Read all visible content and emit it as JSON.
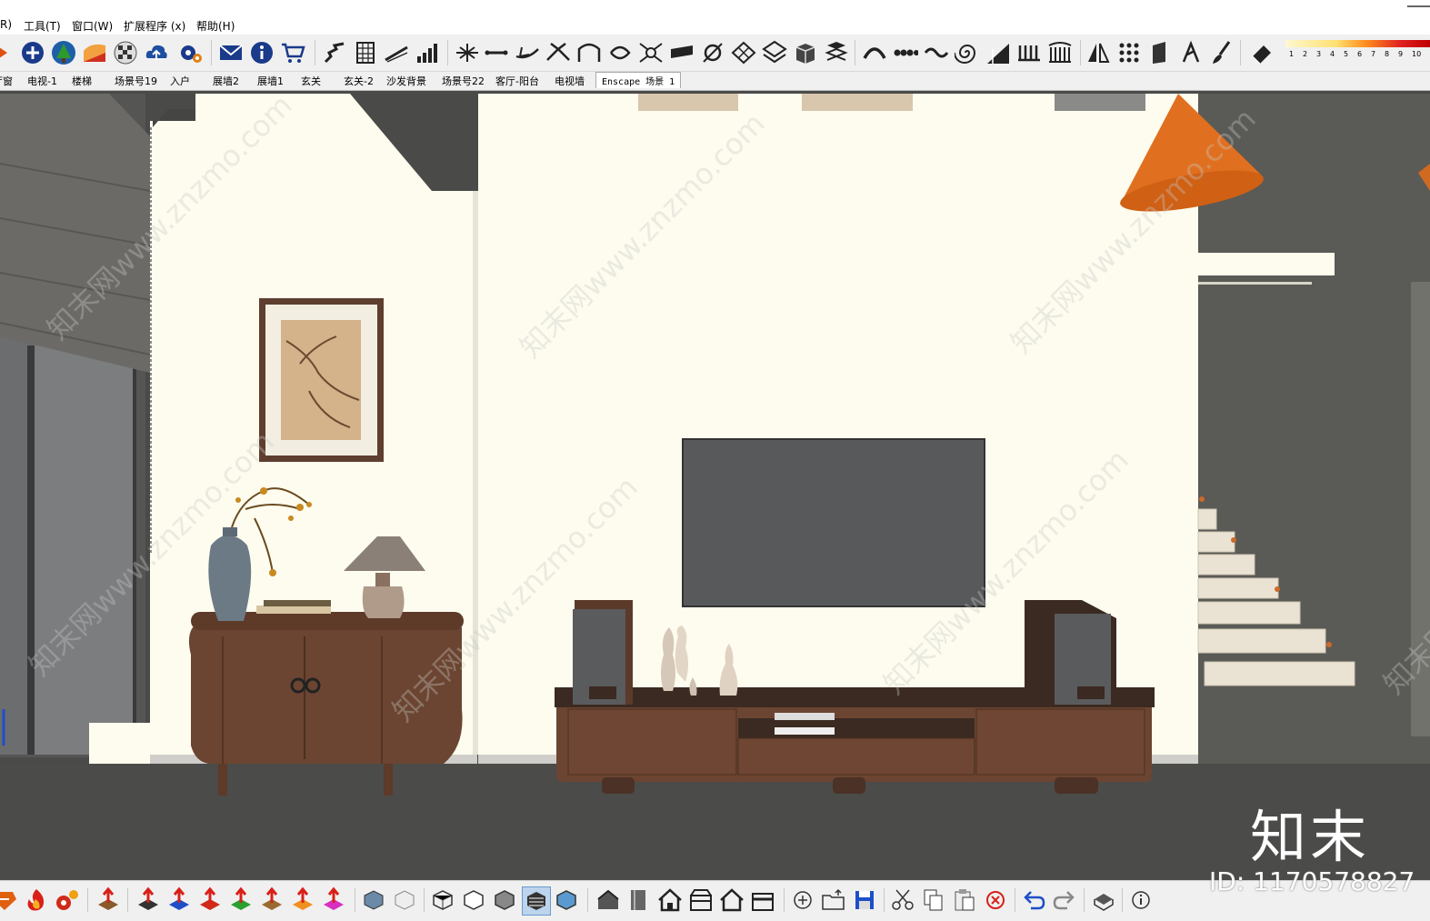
{
  "menubar": {
    "items": [
      "R)",
      "工具(T)",
      "窗口(W)",
      "扩展程序 (x)",
      "帮助(H)"
    ]
  },
  "scene_tabs": [
    "厅窗",
    "电视-1",
    "楼梯",
    "场景号19",
    "入户",
    "展墙2",
    "展墙1",
    "玄关",
    "玄关-2",
    "沙发背景",
    "场景号22",
    "客厅-阳台",
    "电视墙",
    "Enscape 场景 1"
  ],
  "active_tab_index": 13,
  "color_scale": {
    "numbers": [
      "1",
      "2",
      "3",
      "4",
      "5",
      "6",
      "7",
      "8",
      "9",
      "10"
    ]
  },
  "watermark": {
    "text": "知末网www.znzmo.com",
    "logo": "知末",
    "id": "ID: 1170578827"
  },
  "colors": {
    "wall": "#fdfcee",
    "floor": "#4a4a48",
    "tv": "#58595b",
    "wood": "#6b4531",
    "lamp_shade": "#e07020",
    "accent_blue": "#1e4fc8"
  },
  "icons": {
    "toolbar": [
      "shape-icon",
      "add-icon",
      "tree-icon",
      "sandbox-icon",
      "checker-icon",
      "cloud-upload-icon",
      "gear-icon",
      "mail-icon",
      "info-icon",
      "cart-icon",
      "stairs-icon",
      "building-icon",
      "slope-icon",
      "bar-chart-icon",
      "joint-icon",
      "line-icon",
      "arrow-icon",
      "arrows-icon",
      "arch-icon",
      "curve-icon",
      "node-icon",
      "slab-icon",
      "circle-icon",
      "grid-icon",
      "stack-icon",
      "box-icon",
      "layers-icon",
      "dome-icon",
      "chain-icon",
      "wave-icon",
      "spiral-icon",
      "ramp-icon",
      "columns-icon",
      "colonnade-icon",
      "mirror-icon",
      "dots-grid-icon",
      "panel-icon",
      "draw-icon",
      "brush-icon",
      "eraser-icon"
    ],
    "bottom": [
      "ruby-icon",
      "fire-icon",
      "gear-icon",
      "push-up-icon",
      "move-icon",
      "push-blue-icon",
      "push-red-icon",
      "push-green-icon",
      "push-orange-icon",
      "push-x-icon",
      "push-pink-icon",
      "iso-view-icon",
      "top-view-icon",
      "front-view-icon",
      "right-view-icon",
      "back-view-icon",
      "left-view-icon",
      "bottom-view-icon",
      "shaded-icon",
      "house-front-icon",
      "book-icon",
      "house-icon",
      "box-open-icon",
      "house-outline-icon",
      "box-closed-icon",
      "zoom-icon",
      "open-folder-icon",
      "save-icon",
      "cut-icon",
      "copy-icon",
      "paste-icon",
      "delete-icon",
      "undo-icon",
      "redo-icon",
      "print-icon",
      "model-info-icon"
    ]
  }
}
